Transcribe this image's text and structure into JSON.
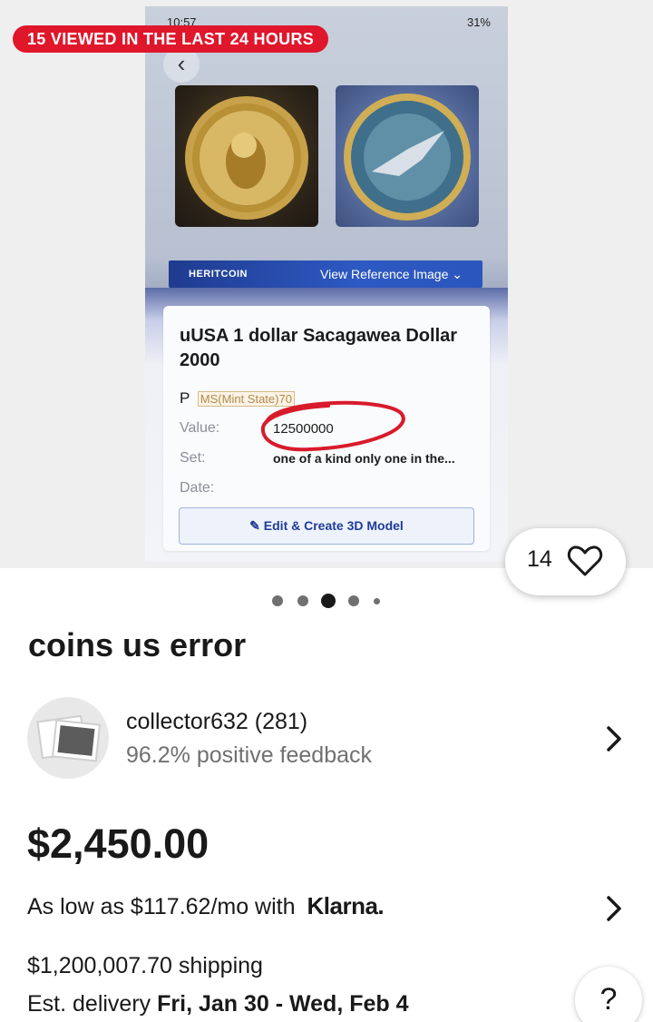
{
  "gallery": {
    "status_time": "10:57",
    "status_right": "31%",
    "viewed_badge": "15 VIEWED IN THE LAST 24 HOURS",
    "brand_logo": "HERITCOIN",
    "reference_link": "View Reference Image",
    "card": {
      "title": "uUSA 1 dollar  Sacagawea Dollar 2000",
      "grade_letter": "P",
      "grade_tag": "MS(Mint State)70",
      "value_label": "Value:",
      "value": "12500000",
      "set_label": "Set:",
      "set_value": "one of a kind only one in the...",
      "date_label": "Date:",
      "edit_button": "Edit & Create 3D Model"
    },
    "watch_count": "14",
    "page_indicator": {
      "count": 5,
      "active_index": 2
    }
  },
  "listing": {
    "title": "coins us error",
    "seller": {
      "name": "collector632 (281)",
      "feedback": "96.2% positive feedback"
    },
    "price": "$2,450.00",
    "financing": {
      "text": "As low as $117.62/mo with",
      "provider": "Klarna."
    },
    "shipping": "$1,200,007.70 shipping",
    "delivery_label": "Est. delivery",
    "delivery_range": "Fri, Jan 30 - Wed, Feb 4",
    "help_label": "?"
  },
  "colors": {
    "badge_red": "#e0162b",
    "text_dark": "#191919",
    "text_muted": "#707070",
    "brand_blue": "#2d59c2",
    "annotation_red": "#d81b2b"
  }
}
